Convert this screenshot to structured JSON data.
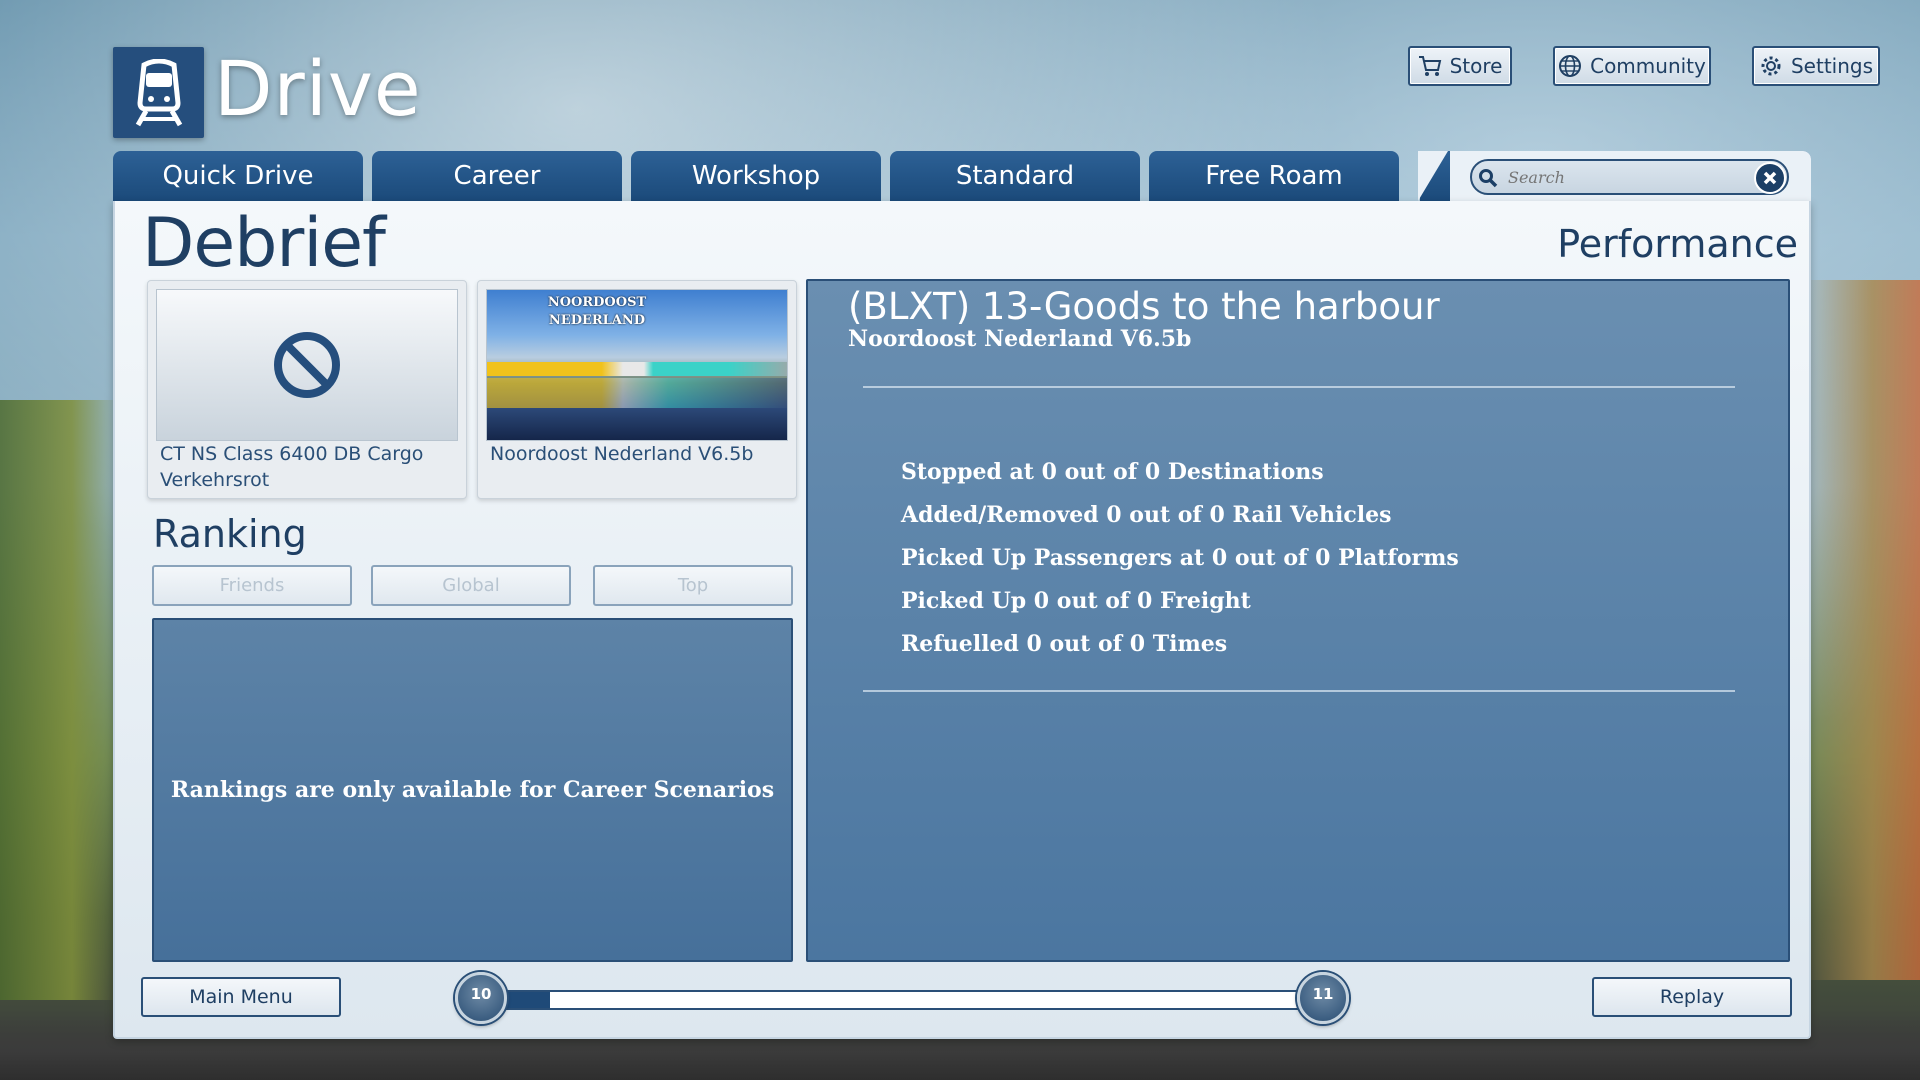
{
  "app": {
    "title": "Drive"
  },
  "top_buttons": {
    "store": "Store",
    "community": "Community",
    "settings": "Settings"
  },
  "tabs": [
    {
      "label": "Quick Drive"
    },
    {
      "label": "Career"
    },
    {
      "label": "Workshop"
    },
    {
      "label": "Standard"
    },
    {
      "label": "Free Roam"
    }
  ],
  "search": {
    "placeholder": "Search",
    "value": ""
  },
  "page": {
    "title": "Debrief",
    "performance_title": "Performance"
  },
  "cards": [
    {
      "label": "CT NS Class 6400 DB Cargo Verkehrsrot",
      "icon": "no-symbol-icon"
    },
    {
      "label": "Noordoost Nederland V6.5b",
      "image_text_line1": "NOORDOOST",
      "image_text_line2": "NEDERLAND"
    }
  ],
  "ranking": {
    "title": "Ranking",
    "buttons": [
      "Friends",
      "Global",
      "Top"
    ],
    "message": "Rankings are only available for Career Scenarios"
  },
  "scenario": {
    "title": "(BLXT) 13-Goods to the harbour",
    "route": "Noordoost Nederland V6.5b",
    "stats": [
      "Stopped at 0 out of 0 Destinations",
      "Added/Removed 0 out of 0 Rail Vehicles",
      "Picked Up Passengers at 0 out of 0 Platforms",
      "Picked Up 0 out of 0 Freight",
      "Refuelled 0 out of 0 Times"
    ]
  },
  "footer": {
    "main_menu": "Main Menu",
    "replay": "Replay",
    "level_from": "10",
    "level_to": "11",
    "progress_fraction": 0.06
  },
  "colors": {
    "accent": "#1f4a78",
    "panel_blue": "#4b76a0",
    "text_dark": "#1f3f63"
  }
}
